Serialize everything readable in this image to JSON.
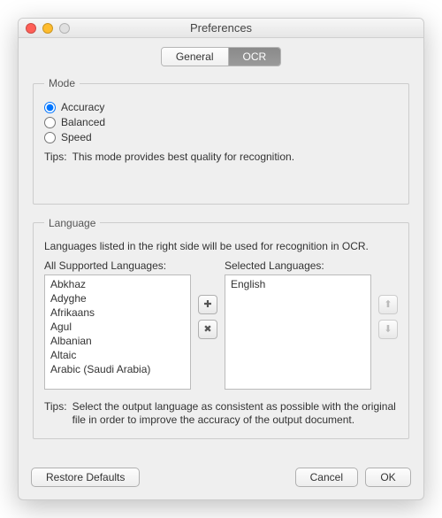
{
  "window": {
    "title": "Preferences"
  },
  "tabs": {
    "general": "General",
    "ocr": "OCR"
  },
  "mode": {
    "legend": "Mode",
    "options": {
      "accuracy": "Accuracy",
      "balanced": "Balanced",
      "speed": "Speed"
    },
    "selected": "accuracy",
    "tips_label": "Tips:",
    "tips_text": "This mode provides best quality for recognition."
  },
  "language": {
    "legend": "Language",
    "desc": "Languages listed in the right side will be used for recognition in OCR.",
    "all_label": "All Supported Languages:",
    "selected_label": "Selected Languages:",
    "all_items": [
      "Abkhaz",
      "Adyghe",
      "Afrikaans",
      "Agul",
      "Albanian",
      "Altaic",
      "Arabic (Saudi Arabia)"
    ],
    "selected_items": [
      "English"
    ],
    "tips_label": "Tips:",
    "tips_text": "Select the output language as consistent as possible with the original file in order to improve the accuracy of the output document."
  },
  "buttons": {
    "restore": "Restore Defaults",
    "cancel": "Cancel",
    "ok": "OK"
  }
}
